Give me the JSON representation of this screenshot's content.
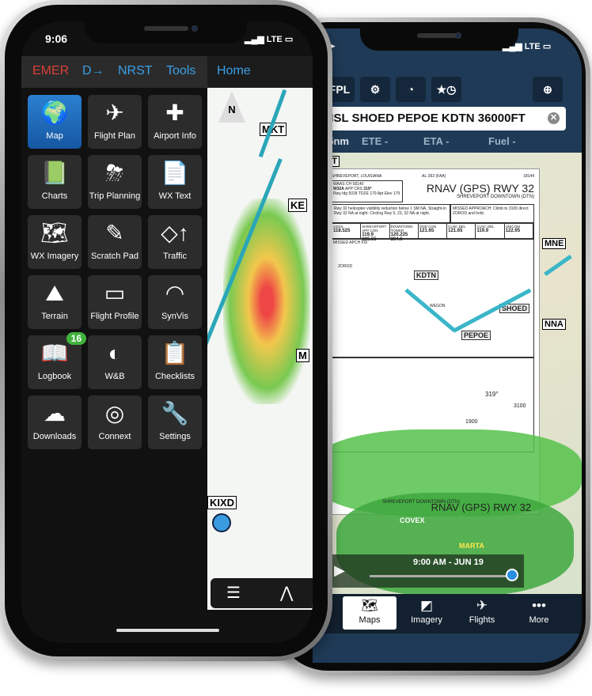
{
  "right_phone": {
    "toolbar": {
      "fpl": "FPL",
      "gear_icon": "gear-icon",
      "gauge_icon": "gauge-icon",
      "star_clock_icon": "star-clock-icon",
      "target_icon": "crosshair-icon"
    },
    "route_input": "MSL SHOED PEPOE KDTN 36000FT",
    "info": {
      "distance": "55nm",
      "ete": "ETE -",
      "eta": "ETA -",
      "fuel": "Fuel -"
    },
    "map_labels": {
      "edt": "EDT",
      "mne": "MNE",
      "nna": "NNA",
      "covex": "COVEX",
      "marta": "MARTA"
    },
    "plate": {
      "location": "SHREVEPORT, LOUISIANA",
      "al": "AL-392 (FAA)",
      "date": "18144",
      "waas": "WAAS",
      "ch": "CH 58140",
      "w": "W32A",
      "app_crs": "APP CRS",
      "crs": "319°",
      "rwy_ldg": "Rwy Idg 5018",
      "tdze": "TDZE 179",
      "apt_elev": "Apt Elev 179",
      "title": "RNAV (GPS) RWY 32",
      "airport": "SHREVEPORT DOWNTOWN (DTN)",
      "notes": "Rwy 32 helicopter visibility reduction below 1 SM NA. Straight-in Rwy 32 NA at night. Circling Rwy 5, 23, 32 NA at night.",
      "missed": "MISSED APPROACH: Climb to 3100 direct ZOROD and hold.",
      "freqs": [
        {
          "name": "ASOS",
          "val": "118.525"
        },
        {
          "name": "SHREVEPORT APP CON",
          "val": "119.9 335.55"
        },
        {
          "name": "DOWNTOWN TOWER",
          "val": "120.225 284.6"
        },
        {
          "name": "GND CON",
          "val": "121.65"
        },
        {
          "name": "CLNC DEL",
          "val": "121.65"
        },
        {
          "name": "CLNC DEL",
          "val": "119.9"
        },
        {
          "name": "UNICOM",
          "val": "122.95"
        }
      ],
      "missed_fix": "MISSED APCH FIX",
      "zorod": "ZOROD",
      "fixes": {
        "kdtn": "KDTN",
        "shoed": "SHOED",
        "pepoe": "PEPOE"
      },
      "wegon": "WEGON",
      "course": "319°",
      "alt": "3100",
      "alt2": "1900",
      "footer": "RNAV (GPS) RWY 32",
      "footer_airport": "SHREVEPORT DOWNTOWN (DTN)"
    },
    "timeline": {
      "label": "9:00 AM - JUN 19",
      "play_icon": "play-icon",
      "progress": 1.0
    },
    "tabs": [
      {
        "label": "Maps",
        "icon": "map-icon",
        "selected": true
      },
      {
        "label": "Imagery",
        "icon": "imagery-icon"
      },
      {
        "label": "Flights",
        "icon": "flights-icon"
      },
      {
        "label": "More",
        "icon": "more-icon"
      }
    ],
    "status": "LTE"
  },
  "left_phone": {
    "status": {
      "time": "9:06",
      "network": "LTE"
    },
    "menu": {
      "emer": "EMER",
      "direct": "D→",
      "nrst": "NRST",
      "tools": "Tools",
      "home": "Home"
    },
    "colors": {
      "emer": "#d8413a",
      "menu": "#3aa0e6"
    },
    "tiles": [
      {
        "label": "Map",
        "icon": "🌍",
        "selected": true
      },
      {
        "label": "Flight Plan",
        "icon": "✈"
      },
      {
        "label": "Airport Info",
        "icon": "✚"
      },
      {
        "label": "Charts",
        "icon": "📗"
      },
      {
        "label": "Trip Planning",
        "icon": "⛈"
      },
      {
        "label": "WX Text",
        "icon": "📄"
      },
      {
        "label": "WX Imagery",
        "icon": "🗺"
      },
      {
        "label": "Scratch Pad",
        "icon": "✎"
      },
      {
        "label": "Traffic",
        "icon": "◇↑"
      },
      {
        "label": "Terrain",
        "icon": "⛰"
      },
      {
        "label": "Flight Profile",
        "icon": "▭"
      },
      {
        "label": "SynVis",
        "icon": "◠"
      },
      {
        "label": "Logbook",
        "icon": "📖",
        "badge": "16"
      },
      {
        "label": "W&B",
        "icon": "◐"
      },
      {
        "label": "Checklists",
        "icon": "📋"
      },
      {
        "label": "Downloads",
        "icon": "☁"
      },
      {
        "label": "Connext",
        "icon": "◎"
      },
      {
        "label": "Settings",
        "icon": "🔧"
      }
    ],
    "map_labels": {
      "north": "N",
      "mkt": "MKT",
      "ke": "KE",
      "m": "M",
      "kixd": "KIXD"
    },
    "map_buttons": {
      "layers_icon": "layers-icon",
      "profile_icon": "route-icon"
    }
  }
}
